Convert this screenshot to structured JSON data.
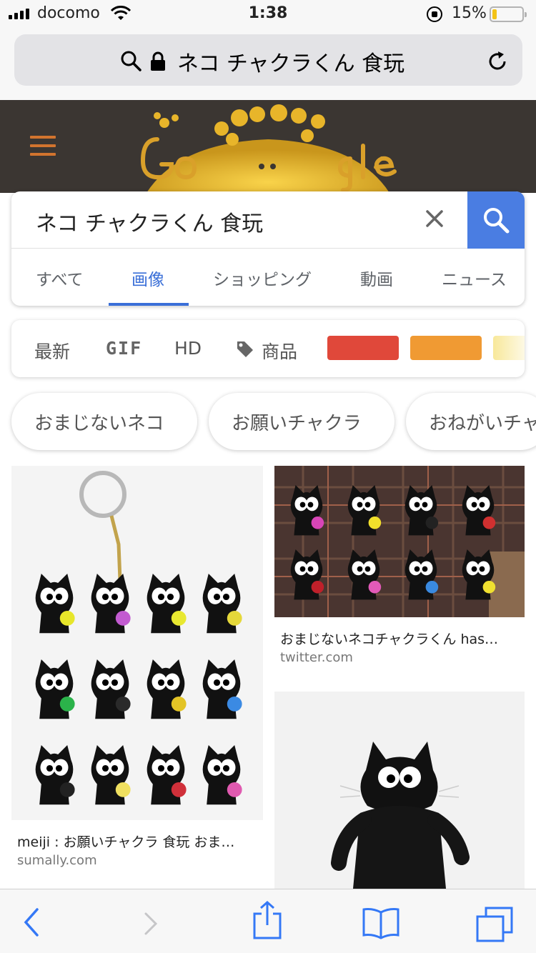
{
  "status_bar": {
    "carrier": "docomo",
    "time": "1:38",
    "battery_percent": "15%",
    "battery_level": 0.15
  },
  "address_bar": {
    "url_text": "ネコ チャクラくん 食玩"
  },
  "search": {
    "query": "ネコ チャクラくん 食玩",
    "tabs": [
      {
        "label": "すべて"
      },
      {
        "label": "画像"
      },
      {
        "label": "ショッピング"
      },
      {
        "label": "動画"
      },
      {
        "label": "ニュース"
      }
    ],
    "active_tab": "画像"
  },
  "filters": {
    "latest": "最新",
    "gif": "GIF",
    "hd": "HD",
    "products": "商品",
    "color_swatches": [
      "#e0483a",
      "#f09a33",
      "#f8e89a"
    ]
  },
  "chips": [
    {
      "label": "おまじないネコ"
    },
    {
      "label": "お願いチャクラ"
    },
    {
      "label": "おねがいチャ"
    }
  ],
  "results": [
    {
      "title": "meiji : お願いチャクラ 食玩 おま…",
      "source": "sumally.com"
    },
    {
      "title": "おまじないネコチャクラくん has…",
      "source": "twitter.com"
    }
  ],
  "colors": {
    "accent": "#3a6fd8",
    "search_button": "#4a7de2",
    "header_bg": "#3b3632",
    "menu_icon": "#d2742e"
  }
}
